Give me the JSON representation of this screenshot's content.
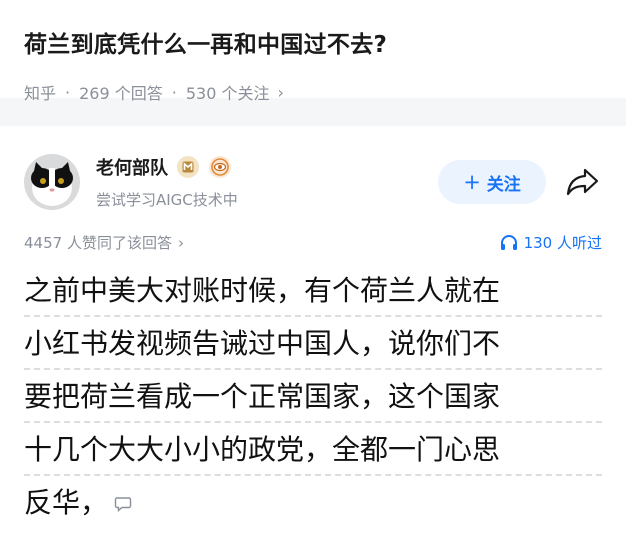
{
  "question": {
    "title": "荷兰到底凭什么一再和中国过不去?",
    "source": "知乎",
    "answers_count": "269 个回答",
    "followers_count": "530 个关注",
    "chevron": "›"
  },
  "answer": {
    "author_name": "老何部队",
    "author_bio": "尝试学习AIGC技术中",
    "follow_label": "关注",
    "follow_plus": "+",
    "likes_text": "4457 人赞同了该回答",
    "listen_text": "130 人听过",
    "body_lines": [
      "之前中美大对账时候，有个荷兰人就在",
      "小红书发视频告诫过中国人，说你们不",
      "要把荷兰看成一个正常国家，这个国家",
      "十几个大大小小的政党，全都一门心思",
      "反华，"
    ],
    "icons": {
      "badge1": "creator-badge-icon",
      "badge2": "eye-badge-icon",
      "share": "share-icon",
      "listen": "headphones-icon",
      "comment": "comment-icon"
    }
  },
  "colors": {
    "accent": "#1772f6",
    "follow_bg": "#ebf3ff",
    "meta_gray": "#8a8f99",
    "divider": "#f5f6f7"
  }
}
